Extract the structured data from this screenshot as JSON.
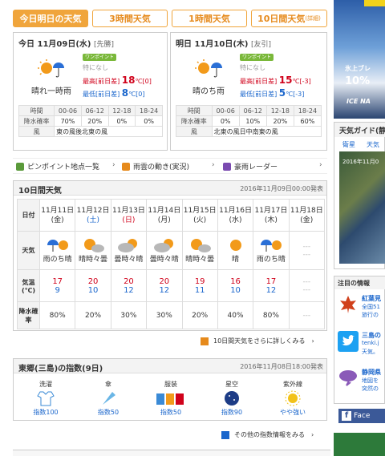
{
  "tabs": [
    {
      "label": "今日明日の天気",
      "sub": ""
    },
    {
      "label": "3時間天気",
      "sub": ""
    },
    {
      "label": "1時間天気",
      "sub": ""
    },
    {
      "label": "10日間天気",
      "sub": "(詳細)"
    }
  ],
  "today": {
    "title": "今日 11月09日(水)",
    "rokuyo": "[先勝]",
    "weather": "晴れ一時雨",
    "onepoint": "ワンポイント",
    "onepoint_text": "特になし",
    "hi_label": "最高[前日差]",
    "hi": "18",
    "hi_unit": "℃",
    "hi_diff": "[0]",
    "lo_label": "最低[前日差]",
    "lo": "8",
    "lo_unit": "℃",
    "lo_diff": "[0]",
    "time_label": "時間",
    "periods": [
      "00-06",
      "06-12",
      "12-18",
      "18-24"
    ],
    "rain_label": "降水確率",
    "rain": [
      "70%",
      "20%",
      "0%",
      "0%"
    ],
    "wind_label": "風",
    "wind": "東の風後北東の風"
  },
  "tomorrow": {
    "title": "明日 11月10日(木)",
    "rokuyo": "[友引]",
    "weather": "晴のち雨",
    "onepoint": "ワンポイント",
    "onepoint_text": "特になし",
    "hi_label": "最高[前日差]",
    "hi": "15",
    "hi_unit": "℃",
    "hi_diff": "[-3]",
    "lo_label": "最低[前日差]",
    "lo": "5",
    "lo_unit": "℃",
    "lo_diff": "[-3]",
    "time_label": "時間",
    "periods": [
      "00-06",
      "06-12",
      "12-18",
      "18-24"
    ],
    "rain_label": "降水確率",
    "rain": [
      "0%",
      "10%",
      "20%",
      "60%"
    ],
    "wind_label": "風",
    "wind": "北東の風日中南東の風"
  },
  "links": [
    {
      "label": "ピンポイント地点一覧",
      "icon": "pin-icon",
      "color": "#5a9a3a"
    },
    {
      "label": "雨雲の動き(実況)",
      "icon": "cloud-icon",
      "color": "#e68a1c"
    },
    {
      "label": "豪雨レーダー",
      "icon": "radar-icon",
      "color": "#7a4ab0"
    }
  ],
  "ten_day": {
    "title": "10日間天気",
    "issued": "2016年11月09日00:00発表",
    "row_labels": {
      "date": "日付",
      "weather": "天気",
      "temp": "気温(℃)",
      "rain": "降水確率"
    },
    "days": [
      {
        "date": "11月11日",
        "wd": "(金)",
        "weather": "雨のち晴",
        "icon": "rain-then-sun-icon",
        "hi": "17",
        "lo": "9",
        "rain": "80%",
        "cls": ""
      },
      {
        "date": "11月12日",
        "wd": "(土)",
        "weather": "晴時々曇",
        "icon": "sun-cloud-icon",
        "hi": "20",
        "lo": "10",
        "rain": "20%",
        "cls": "sat"
      },
      {
        "date": "11月13日",
        "wd": "(日)",
        "weather": "曇時々晴",
        "icon": "cloud-sun-icon",
        "hi": "20",
        "lo": "12",
        "rain": "30%",
        "cls": "sun"
      },
      {
        "date": "11月14日",
        "wd": "(月)",
        "weather": "曇時々晴",
        "icon": "cloud-sun-icon",
        "hi": "20",
        "lo": "12",
        "rain": "30%",
        "cls": ""
      },
      {
        "date": "11月15日",
        "wd": "(火)",
        "weather": "晴時々曇",
        "icon": "sun-cloud-icon",
        "hi": "19",
        "lo": "11",
        "rain": "20%",
        "cls": ""
      },
      {
        "date": "11月16日",
        "wd": "(水)",
        "weather": "晴",
        "icon": "sun-icon",
        "hi": "16",
        "lo": "10",
        "rain": "40%",
        "cls": ""
      },
      {
        "date": "11月17日",
        "wd": "(木)",
        "weather": "雨のち晴",
        "icon": "rain-then-sun-icon",
        "hi": "17",
        "lo": "12",
        "rain": "80%",
        "cls": ""
      },
      {
        "date": "11月18日",
        "wd": "(金)",
        "weather": "---",
        "icon": "",
        "hi": "---",
        "lo": "---",
        "rain": "---",
        "cls": ""
      }
    ],
    "more": "10日間天気をさらに詳しくみる"
  },
  "indices": {
    "title": "東郷(三島)の指数(9日)",
    "issued": "2016年11月08日18:00発表",
    "items": [
      {
        "name": "洗濯",
        "level": "指数100",
        "icon": "laundry-icon"
      },
      {
        "name": "傘",
        "level": "指数50",
        "icon": "umbrella-icon"
      },
      {
        "name": "服装",
        "level": "指数50",
        "icon": "clothes-icon"
      },
      {
        "name": "星空",
        "level": "指数90",
        "icon": "starry-sky-icon"
      },
      {
        "name": "紫外線",
        "level": "やや強い",
        "icon": "uv-icon"
      }
    ],
    "more": "その他の指数情報をみる"
  },
  "sidebar": {
    "ad_line1": "氷上ブレ",
    "ad_line2": "10%",
    "ad_line3": "ICE NA",
    "guide_title": "天気ガイド(静",
    "guide_tabs": [
      "衛星",
      "天気"
    ],
    "map_date": "2016年11月0",
    "notice_title": "注目の情報",
    "notices": [
      {
        "a": "紅葉見",
        "b": "全国51",
        "c": "旅行の",
        "icon": "maple-icon"
      },
      {
        "a": "三島の",
        "b": "tenki.j",
        "c": "天気。",
        "icon": "twitter-icon"
      },
      {
        "a": "静岡県",
        "b": "地図を",
        "c": "突然の",
        "icon": "thunder-cloud-icon"
      }
    ],
    "facebook": "Face"
  }
}
